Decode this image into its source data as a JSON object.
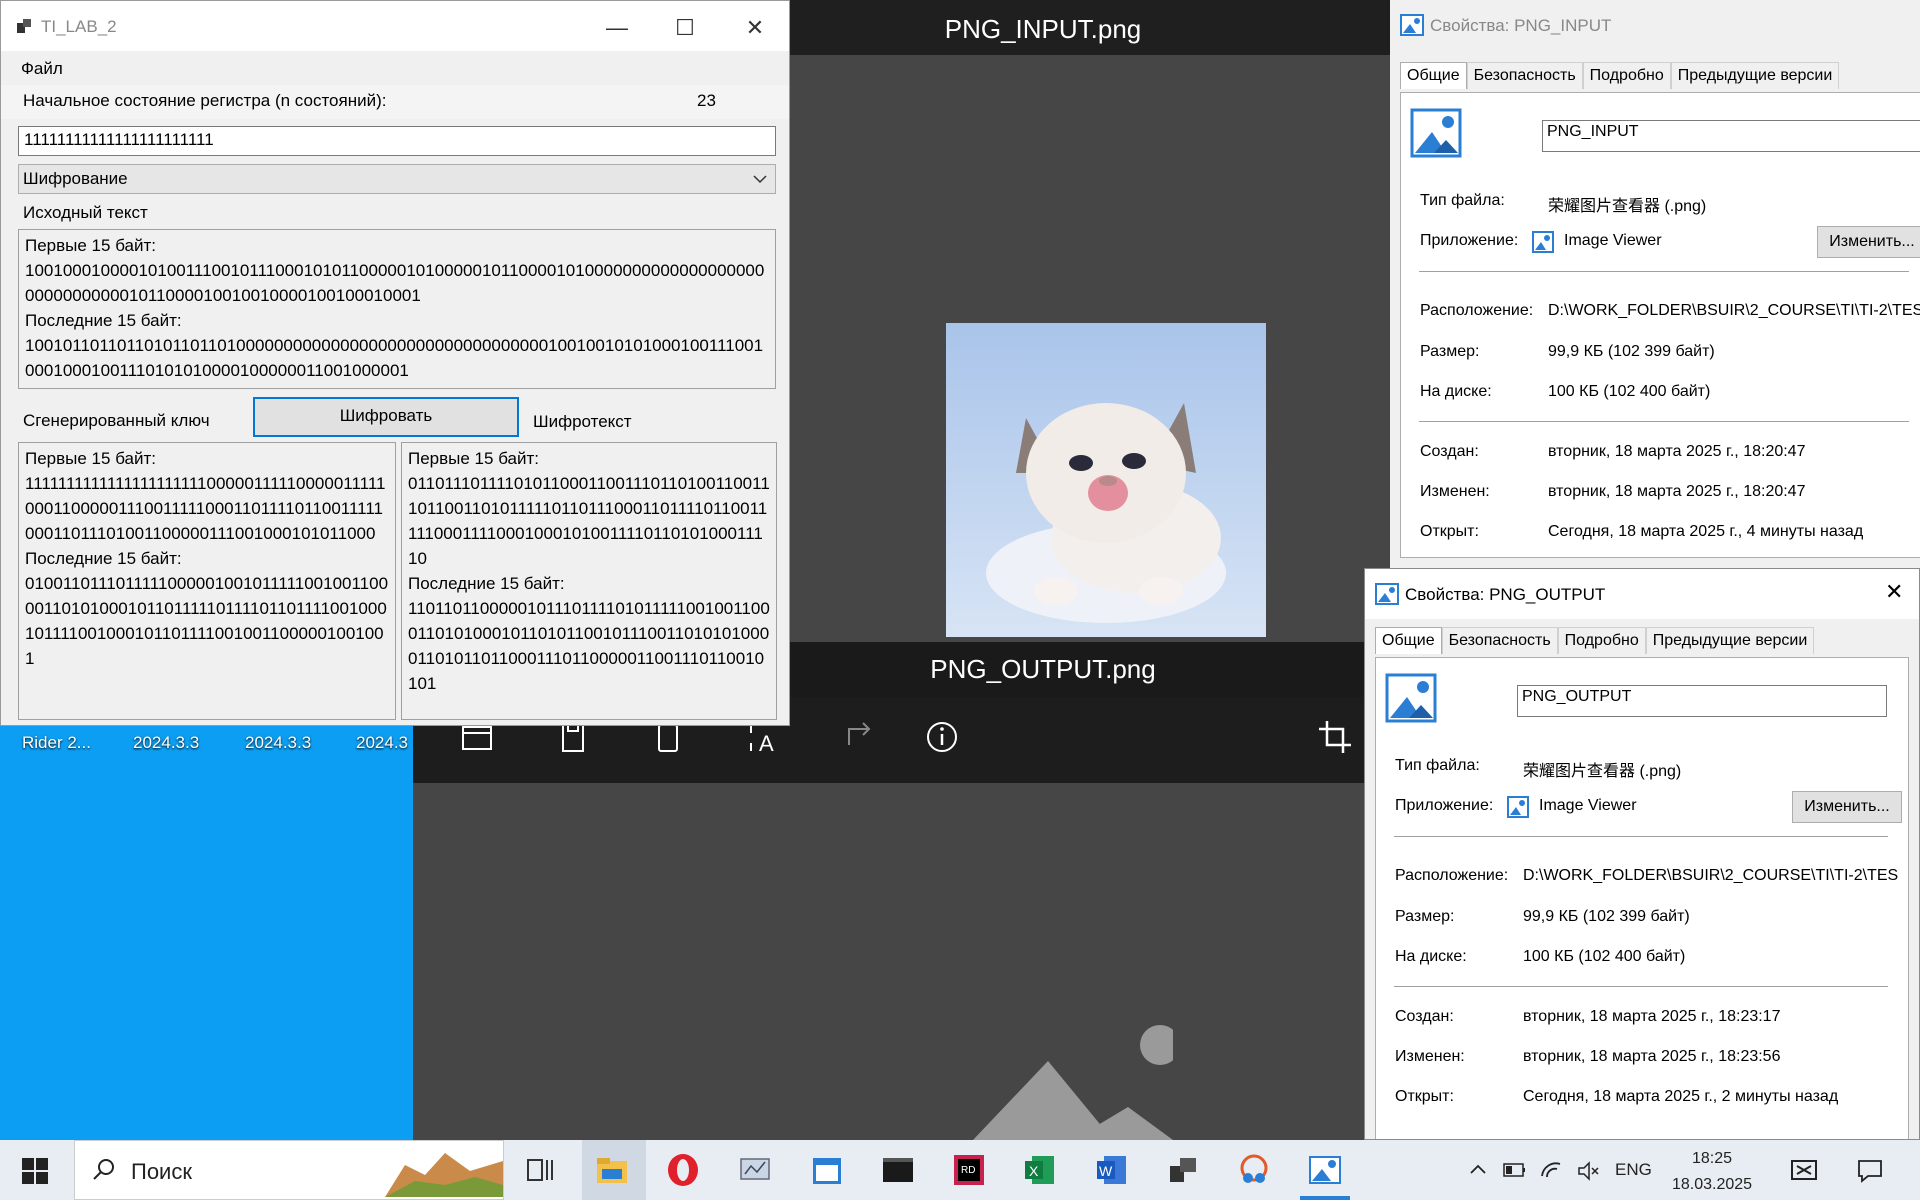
{
  "desktop": {
    "icon_labels": [
      "Rider 2...",
      "2024.3.3",
      "2024.3.3",
      "2024.3"
    ]
  },
  "viewer": {
    "title_top": "PNG_INPUT.png",
    "title_bottom": "PNG_OUTPUT.png",
    "toolbar_icons": [
      "folder-icon",
      "save-icon",
      "rotate-icon",
      "text-recognition-icon",
      "share-icon",
      "info-icon",
      "crop-icon"
    ]
  },
  "app": {
    "title": "TI_LAB_2",
    "menu_file": "Файл",
    "register_label": "Начальное состояние регистра (n состояний):",
    "register_count": "23",
    "register_value": "11111111111111111111111",
    "mode": "Шифрование",
    "source_label": "Исходный текст",
    "source_text": "Первые 15 байт:\n1001000100001010011100101110001010110000010100000101100001010000000000000000000000000000001011000010010010000100100010001\nПоследние 15 байт:\n100101101101101011011010000000000000000000000000000000001001001010100010011100100010001001110101010000100000011001000001",
    "key_label": "Сгенерированный ключ",
    "encrypt_button": "Шифровать",
    "cipher_label": "Шифротекст",
    "key_text": "Первые 15 байт:\n111111111111111111111100000111110000011111000110000011100111110001101111011001111100011011101001100000111001000101011000\nПоследние 15 байт:\n010011011101111100000100101111100100110000110101000101101111101111011011110010001011110010001011011110010011000001001001",
    "cipher_text": "Первые 15 байт:\n0110111011110101100011001110110100110011101100110101111101101110001101111011001111100011110001000101001111011010100011110\nПоследние 15 байт:\n1101101100000101110111101011111001001100011010100010110101100101110011010101000011010110110001110110000011001110110010101"
  },
  "props_input": {
    "title": "Свойства: PNG_INPUT",
    "tabs": [
      "Общие",
      "Безопасность",
      "Подробно",
      "Предыдущие версии"
    ],
    "name": "PNG_INPUT",
    "type_label": "Тип файла:",
    "type_value": "荣耀图片查看器 (.png)",
    "app_label": "Приложение:",
    "app_value": "Image Viewer",
    "change_button": "Изменить...",
    "location_label": "Расположение:",
    "location_value": "D:\\WORK_FOLDER\\BSUIR\\2_COURSE\\TI\\TI-2\\TES",
    "size_label": "Размер:",
    "size_value": "99,9 КБ (102 399 байт)",
    "disk_label": "На диске:",
    "disk_value": "100 КБ (102 400 байт)",
    "created_label": "Создан:",
    "created_value": "вторник, 18 марта 2025 г., 18:20:47",
    "modified_label": "Изменен:",
    "modified_value": "вторник, 18 марта 2025 г., 18:20:47",
    "opened_label": "Открыт:",
    "opened_value": "Сегодня, 18 марта 2025 г., 4 минуты назад"
  },
  "props_output": {
    "title": "Свойства: PNG_OUTPUT",
    "tabs": [
      "Общие",
      "Безопасность",
      "Подробно",
      "Предыдущие версии"
    ],
    "name": "PNG_OUTPUT",
    "type_label": "Тип файла:",
    "type_value": "荣耀图片查看器 (.png)",
    "app_label": "Приложение:",
    "app_value": "Image Viewer",
    "change_button": "Изменить...",
    "location_label": "Расположение:",
    "location_value": "D:\\WORK_FOLDER\\BSUIR\\2_COURSE\\TI\\TI-2\\TES",
    "size_label": "Размер:",
    "size_value": "99,9 КБ (102 399 байт)",
    "disk_label": "На диске:",
    "disk_value": "100 КБ (102 400 байт)",
    "created_label": "Создан:",
    "created_value": "вторник, 18 марта 2025 г., 18:23:17",
    "modified_label": "Изменен:",
    "modified_value": "вторник, 18 марта 2025 г., 18:23:56",
    "opened_label": "Открыт:",
    "opened_value": "Сегодня, 18 марта 2025 г., 2 минуты назад"
  },
  "taskbar": {
    "search_placeholder": "Поиск",
    "lang": "ENG",
    "time": "18:25",
    "date": "18.03.2025",
    "apps": [
      "task-view-icon",
      "file-explorer-icon",
      "opera-icon",
      "monitor-icon",
      "calendar-icon",
      "terminal-icon",
      "rider-icon",
      "excel-icon",
      "word-icon",
      "app-window-icon",
      "paint-icon",
      "photos-icon"
    ]
  }
}
